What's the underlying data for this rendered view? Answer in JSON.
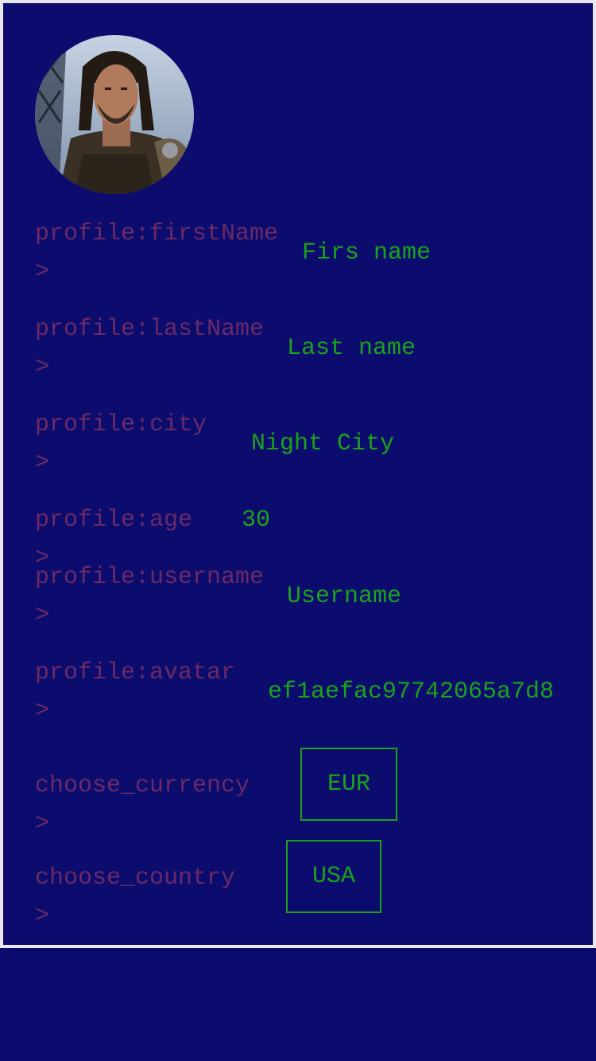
{
  "avatar": {
    "alt": "profile avatar"
  },
  "fields": {
    "firstName": {
      "label": "profile:firstName\n>",
      "value": "Firs name"
    },
    "lastName": {
      "label": "profile:lastName\n>",
      "value": "Last name"
    },
    "city": {
      "label": "profile:city\n>",
      "value": "Night City"
    },
    "age": {
      "label": "profile:age >",
      "value": "30"
    },
    "username": {
      "label": "profile:username\n>",
      "value": "Username"
    },
    "avatar": {
      "label": "profile:avatar\n>",
      "value": "ef1aefac97742065a7d8"
    }
  },
  "currency": {
    "label": "choose_currency >",
    "selected": "EUR"
  },
  "country": {
    "label": "choose_country >",
    "selected": "USA"
  },
  "colors": {
    "background": "#0c0c6e",
    "label": "#6b2a66",
    "value": "#1aa31a",
    "frame": "#e8e8ee"
  }
}
